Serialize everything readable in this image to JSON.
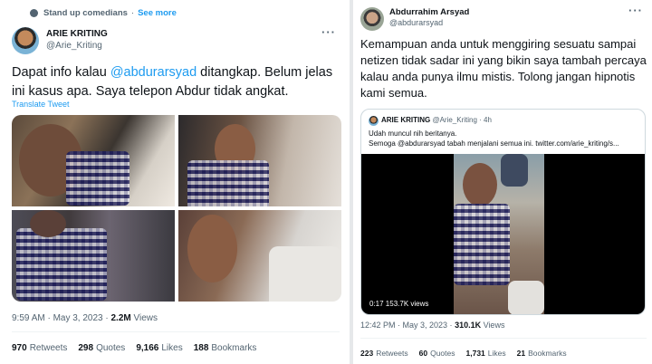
{
  "left_tweet": {
    "context_label": "Stand up comedians",
    "context_sep": "·",
    "context_link": "See more",
    "author_name": "ARIE KRITING",
    "author_handle": "@Arie_Kriting",
    "more_label": "···",
    "text_before": "Dapat info kalau ",
    "mention": "@abdurarsyad",
    "text_after": " ditangkap. Belum jelas ini kasus apa. Saya telepon Abdur tidak angkat.",
    "translate_label": "Translate Tweet",
    "time": "9:59 AM · May 3, 2023 · ",
    "views_count": "2.2M",
    "views_label": " Views",
    "stats": [
      {
        "count": "970",
        "label": "Retweets"
      },
      {
        "count": "298",
        "label": "Quotes"
      },
      {
        "count": "9,166",
        "label": "Likes"
      },
      {
        "count": "188",
        "label": "Bookmarks"
      }
    ]
  },
  "right_tweet": {
    "author_name": "Abdurrahim Arsyad",
    "author_handle": "@abdurarsyad",
    "more_label": "···",
    "text": "Kemampuan anda untuk menggiring sesuatu sampai netizen tidak sadar ini yang bikin saya tambah percaya kalau anda punya ilmu mistis. Tolong jangan hipnotis kami semua.",
    "quote": {
      "author_name": "ARIE KRITING",
      "author_meta": " @Arie_Kriting · 4h",
      "line1": "Udah muncul nih beritanya.",
      "line2": "Semoga @abdurarsyad tabah menjalani semua ini.  twitter.com/arie_kriting/s...",
      "video_time": "0:17   153.7K views"
    },
    "time": "12:42 PM · May 3, 2023 · ",
    "views_count": "310.1K",
    "views_label": " Views",
    "stats": [
      {
        "count": "223",
        "label": "Retweets"
      },
      {
        "count": "60",
        "label": "Quotes"
      },
      {
        "count": "1,731",
        "label": "Likes"
      },
      {
        "count": "21",
        "label": "Bookmarks"
      }
    ]
  },
  "colors": {
    "link": "#1d9bf0",
    "muted": "#536471",
    "text": "#0f1419",
    "border": "#cfd9de"
  }
}
